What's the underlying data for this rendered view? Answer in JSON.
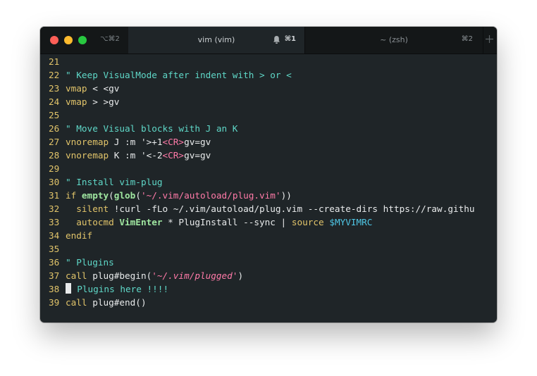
{
  "window": {
    "shortcut": "⌥⌘2",
    "tabs": [
      {
        "title": "vim (vim)",
        "shortcut": "⌘1",
        "active": true
      },
      {
        "title": "~ (zsh)",
        "shortcut": "⌘2",
        "active": false
      }
    ]
  },
  "colors": {
    "background": "#1f2528",
    "line_number": "#e1c46a",
    "comment": "#5fd8c8",
    "string": "#ff7aa8",
    "variable": "#4fc7e6"
  },
  "editor": {
    "lines": [
      {
        "n": "21",
        "segs": []
      },
      {
        "n": "22",
        "segs": [
          {
            "t": "\" Keep VisualMode after indent with > or <",
            "c": "cm"
          }
        ]
      },
      {
        "n": "23",
        "segs": [
          {
            "t": "vmap",
            "c": "kw"
          },
          {
            "t": " < <gv",
            "c": "tx"
          }
        ]
      },
      {
        "n": "24",
        "segs": [
          {
            "t": "vmap",
            "c": "kw"
          },
          {
            "t": " > >gv",
            "c": "tx"
          }
        ]
      },
      {
        "n": "25",
        "segs": []
      },
      {
        "n": "26",
        "segs": [
          {
            "t": "\" Move Visual blocks with J an K",
            "c": "cm"
          }
        ]
      },
      {
        "n": "27",
        "segs": [
          {
            "t": "vnoremap",
            "c": "kw"
          },
          {
            "t": " J :m '>+1",
            "c": "tx"
          },
          {
            "t": "<CR>",
            "c": "ang"
          },
          {
            "t": "gv=gv",
            "c": "tx"
          }
        ]
      },
      {
        "n": "28",
        "segs": [
          {
            "t": "vnoremap",
            "c": "kw"
          },
          {
            "t": " K :m '<-2",
            "c": "tx"
          },
          {
            "t": "<CR>",
            "c": "ang"
          },
          {
            "t": "gv=gv",
            "c": "tx"
          }
        ]
      },
      {
        "n": "29",
        "segs": []
      },
      {
        "n": "30",
        "segs": [
          {
            "t": "\" Install vim-plug",
            "c": "cm"
          }
        ]
      },
      {
        "n": "31",
        "segs": [
          {
            "t": "if ",
            "c": "kw"
          },
          {
            "t": "empty",
            "c": "fn"
          },
          {
            "t": "(",
            "c": "tx"
          },
          {
            "t": "glob",
            "c": "fn"
          },
          {
            "t": "(",
            "c": "tx"
          },
          {
            "t": "'~/.vim/autoload/plug.vim'",
            "c": "str"
          },
          {
            "t": "))",
            "c": "tx"
          }
        ]
      },
      {
        "n": "32",
        "segs": [
          {
            "t": "  silent",
            "c": "kw"
          },
          {
            "t": " !curl -fLo ~/.vim/autoload/plug.vim --create-dirs https://raw.githu",
            "c": "tx"
          }
        ]
      },
      {
        "n": "33",
        "segs": [
          {
            "t": "  autocmd",
            "c": "kw"
          },
          {
            "t": " VimEnter",
            "c": "fn"
          },
          {
            "t": " * PlugInstall --sync | ",
            "c": "tx"
          },
          {
            "t": "source",
            "c": "kw"
          },
          {
            "t": " ",
            "c": "tx"
          },
          {
            "t": "$MYVIMRC",
            "c": "var"
          }
        ]
      },
      {
        "n": "34",
        "segs": [
          {
            "t": "endif",
            "c": "kw"
          }
        ]
      },
      {
        "n": "35",
        "segs": []
      },
      {
        "n": "36",
        "segs": [
          {
            "t": "\" Plugins",
            "c": "cm"
          }
        ]
      },
      {
        "n": "37",
        "segs": [
          {
            "t": "call",
            "c": "kw"
          },
          {
            "t": " plug#begin(",
            "c": "tx"
          },
          {
            "t": "'~/.vim/plugged'",
            "c": "strc"
          },
          {
            "t": ")",
            "c": "tx"
          }
        ]
      },
      {
        "n": "38",
        "cursor": true,
        "segs": [
          {
            "t": "\"",
            "c": "cm"
          },
          {
            "t": " Plugins here !!!!",
            "c": "cm"
          }
        ]
      },
      {
        "n": "39",
        "segs": [
          {
            "t": "call",
            "c": "kw"
          },
          {
            "t": " plug#end()",
            "c": "tx"
          }
        ]
      }
    ]
  }
}
